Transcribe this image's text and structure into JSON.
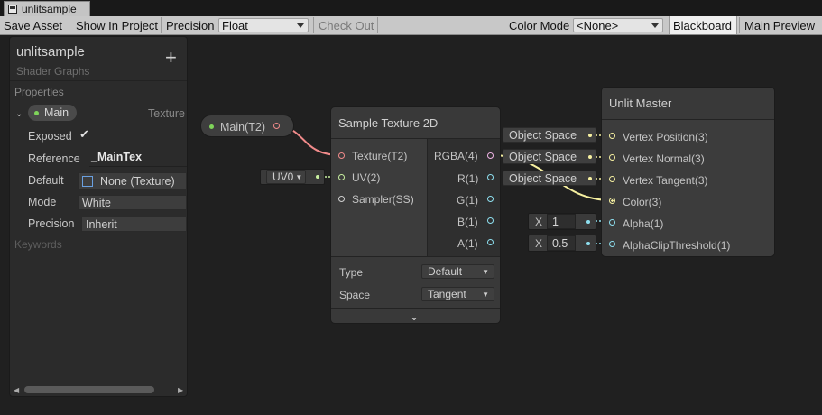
{
  "window": {
    "tab_title": "unlitsample"
  },
  "toolbar": {
    "save_asset": "Save Asset",
    "show_in_project": "Show In Project",
    "precision_label": "Precision",
    "precision_value": "Float",
    "check_out": "Check Out",
    "color_mode_label": "Color Mode",
    "color_mode_value": "<None>",
    "blackboard": "Blackboard",
    "main_preview": "Main Preview"
  },
  "blackboard": {
    "title": "unlitsample",
    "subtitle": "Shader Graphs",
    "add_symbol": "+",
    "properties_section": "Properties",
    "keywords_section": "Keywords",
    "property": {
      "name": "Main",
      "type": "Texture",
      "exposed_label": "Exposed",
      "exposed_checked": true,
      "reference_label": "Reference",
      "reference_value": "_MainTex",
      "default_label": "Default",
      "default_value": "None (Texture)",
      "mode_label": "Mode",
      "mode_value": "White",
      "precision_label": "Precision",
      "precision_value": "Inherit"
    }
  },
  "nodes": {
    "property_node": {
      "label": "Main(T2)"
    },
    "uv_node": {
      "label": "UV0"
    },
    "sample_texture": {
      "title": "Sample Texture 2D",
      "inputs": [
        "Texture(T2)",
        "UV(2)",
        "Sampler(SS)"
      ],
      "outputs": [
        "RGBA(4)",
        "R(1)",
        "G(1)",
        "B(1)",
        "A(1)"
      ],
      "type_label": "Type",
      "type_value": "Default",
      "space_label": "Space",
      "space_value": "Tangent"
    },
    "unlit_master": {
      "title": "Unlit Master",
      "ports": [
        "Vertex Position(3)",
        "Vertex Normal(3)",
        "Vertex Tangent(3)",
        "Color(3)",
        "Alpha(1)",
        "AlphaClipThreshold(1)"
      ]
    },
    "space_chips": [
      "Object Space",
      "Object Space",
      "Object Space"
    ],
    "alpha_input": {
      "axis": "X",
      "value": "1"
    },
    "clip_input": {
      "axis": "X",
      "value": "0.5"
    }
  },
  "colors": {
    "texture_port": "#f08a8a",
    "vector4_port": "#f0b4e6",
    "vector1_port": "#8ee0f0",
    "vector3_port": "#f6f0a0",
    "vector2_port": "#c8f0a0",
    "green_dot": "#7fd45a"
  }
}
